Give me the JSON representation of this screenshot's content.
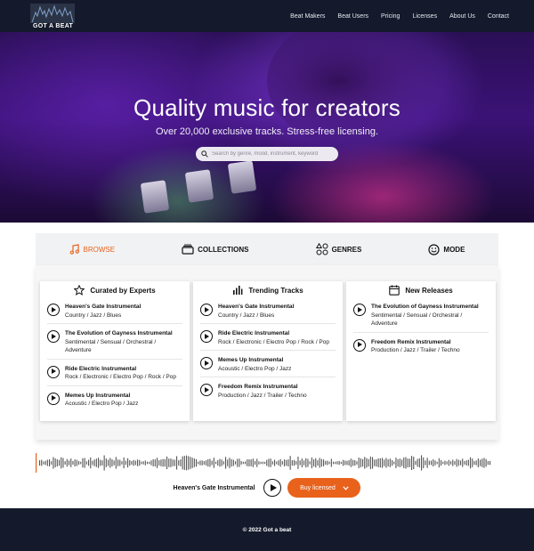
{
  "navbar": {
    "logo_text": "GOT A BEAT",
    "links": [
      "Beat Makers",
      "Beat Users",
      "Pricing",
      "Licenses",
      "About Us",
      "Contact"
    ]
  },
  "hero": {
    "title": "Quality music for creators",
    "subtitle": "Over 20,000 exclusive tracks. Stress-free licensing.",
    "search_placeholder": "Search by genre, mood, instrument, keyword"
  },
  "tabs": [
    {
      "label": "BROWSE",
      "icon": "music-note-icon",
      "active": true
    },
    {
      "label": "COLLECTIONS",
      "icon": "collections-icon",
      "active": false
    },
    {
      "label": "GENRES",
      "icon": "genres-icon",
      "active": false
    },
    {
      "label": "MODE",
      "icon": "smiley-icon",
      "active": false
    }
  ],
  "cards": [
    {
      "title": "Curated by Experts",
      "icon": "star-icon",
      "tracks": [
        {
          "title": "Heaven's Gate Instrumental",
          "tags": "Country / Jazz / Blues"
        },
        {
          "title": "The Evolution of Gayness Instrumental",
          "tags": "Sentimental / Sensual / Orchestral / Adventure"
        },
        {
          "title": "Ride Electric Instrumental",
          "tags": "Rock / Electronic / Electro Pop / Rock / Pop"
        },
        {
          "title": "Memes Up Instrumental",
          "tags": "Acoustic / Electro Pop / Jazz"
        }
      ]
    },
    {
      "title": "Trending Tracks",
      "icon": "bar-chart-icon",
      "tracks": [
        {
          "title": "Heaven's Gate Instrumental",
          "tags": "Country / Jazz / Blues"
        },
        {
          "title": "Ride Electric Instrumental",
          "tags": "Rock / Electronic / Electro Pop / Rock / Pop"
        },
        {
          "title": "Memes Up Instrumental",
          "tags": "Acoustic / Electro Pop / Jazz"
        },
        {
          "title": "Freedom Remix Instrumental",
          "tags": "Production / Jazz / Trailer / Techno"
        }
      ]
    },
    {
      "title": "New Releases",
      "icon": "calendar-icon",
      "tracks": [
        {
          "title": "The Evolution of Gayness Instrumental",
          "tags": "Sentimental / Sensual / Orchestral / Adventure"
        },
        {
          "title": "Freedom Remix Instrumental",
          "tags": "Production / Jazz / Trailer / Techno"
        }
      ]
    }
  ],
  "player": {
    "now_playing": "Heaven's Gate Instrumental",
    "buy_label": "Buy licensed",
    "progress": 0.0
  },
  "footer": {
    "copyright": "© 2022 Got a beat"
  },
  "colors": {
    "accent": "#e8621c",
    "nav_bg": "#141a2b",
    "tab_bg": "#f1f2f4"
  }
}
